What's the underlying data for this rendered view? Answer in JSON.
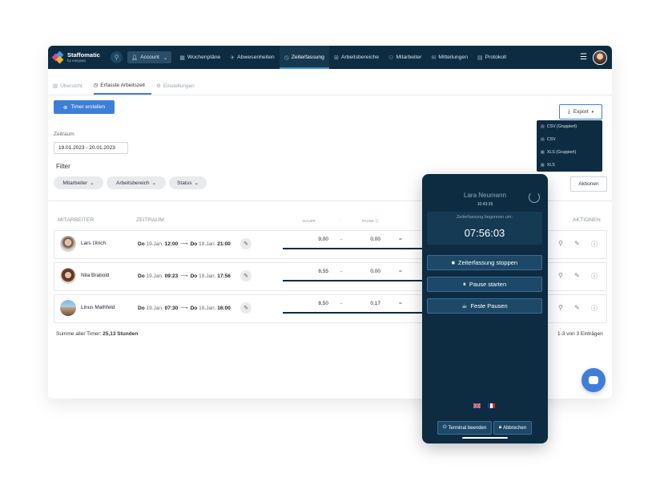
{
  "brand": {
    "name": "Staffomatic",
    "sub": "by easypep"
  },
  "topnav": {
    "account_label": "Account",
    "items": [
      {
        "label": "Wochenpläne",
        "icon": "calendar-icon"
      },
      {
        "label": "Abwesenheiten",
        "icon": "plane-icon"
      },
      {
        "label": "Zeiterfassung",
        "icon": "clock-icon",
        "active": true
      },
      {
        "label": "Arbeitsbereiche",
        "icon": "sitemap-icon"
      },
      {
        "label": "Mitarbeiter",
        "icon": "users-icon"
      },
      {
        "label": "Mitteilungen",
        "icon": "mail-icon"
      },
      {
        "label": "Protokoll",
        "icon": "document-icon"
      }
    ]
  },
  "subtabs": [
    {
      "label": "Übersicht"
    },
    {
      "label": "Erfasste Arbeitszeit",
      "active": true
    },
    {
      "label": "Einstellungen"
    }
  ],
  "timer_button": "Timer erstellen",
  "export": {
    "label": "Export",
    "options": [
      "CSV (Gruppiert)",
      "CSV",
      "XLS (Gruppiert)",
      "XLS"
    ]
  },
  "zeitraum": {
    "label": "Zeitraum",
    "value": "19.01.2023 - 20.01.2023"
  },
  "filter": {
    "label": "Filter",
    "chips": [
      "Mitarbeiter",
      "Arbeitsbereich",
      "Status"
    ]
  },
  "aktionen_button": "Aktionen",
  "table": {
    "headers": {
      "mitarbeiter": "MITARBEITER",
      "zeitraum": "ZEITRAUM",
      "dauer": "DAUER",
      "minus": "-",
      "pause": "PAUSE",
      "aktionen": "AKTIONEN"
    },
    "rows": [
      {
        "name": "Lars Ulrich",
        "start_day": "Do",
        "start_date": "19.Jan.",
        "start_time": "12:00",
        "end_day": "Do",
        "end_date": "19.Jan.",
        "end_time": "21:00",
        "dauer": "9,00",
        "minus": "-",
        "pause": "0,00",
        "eq": "="
      },
      {
        "name": "Nila Brabold",
        "start_day": "Do",
        "start_date": "19.Jan.",
        "start_time": "09:23",
        "end_day": "Do",
        "end_date": "19.Jan.",
        "end_time": "17:56",
        "dauer": "8,55",
        "minus": "-",
        "pause": "0,00",
        "eq": "="
      },
      {
        "name": "Linus Mathfeld",
        "start_day": "Do",
        "start_date": "19.Jan.",
        "start_time": "07:30",
        "end_day": "Do",
        "end_date": "19.Jan.",
        "end_time": "16:00",
        "dauer": "8,50",
        "minus": "-",
        "pause": "0,17",
        "eq": "="
      }
    ]
  },
  "summary": {
    "label": "Summe aller Timer:",
    "value": "25,13 Stunden"
  },
  "pagination": "1-3 von 3 Einträgen",
  "terminal": {
    "name": "Lara Neumann",
    "time": "10:43:39",
    "started_label": "Zeiterfassung begonnen um:",
    "clock": "07:56:03",
    "buttons": [
      "Zeiterfassung stoppen",
      "Pause starten",
      "Feste Pausen"
    ],
    "end_terminal": "Terminal beenden",
    "cancel": "Abbrechen"
  },
  "colors": {
    "navy": "#0d2c42",
    "accent": "#3d7fd8"
  }
}
